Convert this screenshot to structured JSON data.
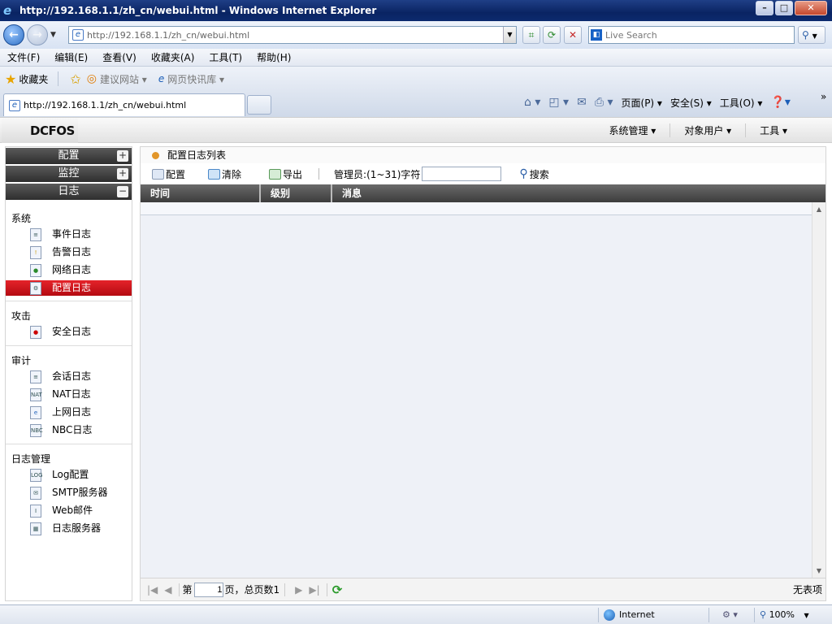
{
  "window": {
    "title": "http://192.168.1.1/zh_cn/webui.html - Windows Internet Explorer"
  },
  "address": {
    "url_prefix": "http://192.168.1.1",
    "url_path": "/zh_cn/webui.html"
  },
  "search": {
    "placeholder": "Live Search"
  },
  "menubar": [
    "文件(F)",
    "编辑(E)",
    "查看(V)",
    "收藏夹(A)",
    "工具(T)",
    "帮助(H)"
  ],
  "favorites": {
    "label": "收藏夹",
    "suggested": "建议网站 ▾",
    "webslice": "网页快讯库 ▾"
  },
  "tab": {
    "title": "http://192.168.1.1/zh_cn/webui.html"
  },
  "cmdbar": {
    "page": "页面(P) ▾",
    "safety": "安全(S) ▾",
    "tools": "工具(O) ▾"
  },
  "app": {
    "logo": "DCFOS",
    "menu": [
      "系统管理 ▾",
      "对象用户 ▾",
      "工具 ▾"
    ]
  },
  "sidebar": {
    "accordions": [
      {
        "label": "配置",
        "sign": "+"
      },
      {
        "label": "监控",
        "sign": "+"
      },
      {
        "label": "日志",
        "sign": "−"
      }
    ],
    "groups": [
      {
        "label": "系统",
        "items": [
          {
            "label": "事件日志"
          },
          {
            "label": "告警日志"
          },
          {
            "label": "网络日志"
          },
          {
            "label": "配置日志",
            "selected": true
          }
        ]
      },
      {
        "label": "攻击",
        "items": [
          {
            "label": "安全日志"
          }
        ]
      },
      {
        "label": "审计",
        "items": [
          {
            "label": "会话日志"
          },
          {
            "label": "NAT日志"
          },
          {
            "label": "上网日志"
          },
          {
            "label": "NBC日志"
          }
        ]
      },
      {
        "label": "日志管理",
        "items": [
          {
            "label": "Log配置"
          },
          {
            "label": "SMTP服务器"
          },
          {
            "label": "Web邮件"
          },
          {
            "label": "日志服务器"
          }
        ]
      }
    ]
  },
  "main": {
    "title": "配置日志列表",
    "toolbar": {
      "config": "配置",
      "clear": "清除",
      "export": "导出",
      "admin_label": "管理员:(1~31)字符",
      "admin_value": "",
      "search": "搜索"
    },
    "columns": [
      "时间",
      "级别",
      "消息"
    ],
    "pager": {
      "page_prefix": "第",
      "page_value": "1",
      "page_suffix": "页，总页数1",
      "no_data": "无表项"
    }
  },
  "status": {
    "zone": "Internet",
    "zoom": "100%"
  }
}
